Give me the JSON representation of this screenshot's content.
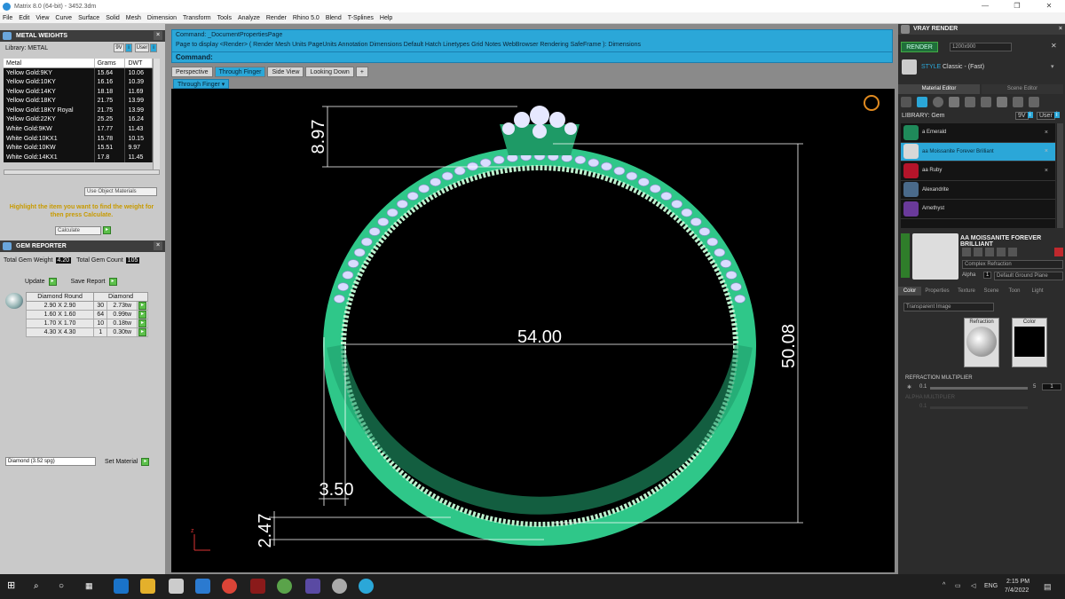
{
  "window": {
    "title": "Matrix 8.0 (64-bit) - 3452.3dm",
    "controls": [
      "—",
      "❐",
      "✕"
    ]
  },
  "menu": [
    "File",
    "Edit",
    "View",
    "Curve",
    "Surface",
    "Solid",
    "Mesh",
    "Dimension",
    "Transform",
    "Tools",
    "Analyze",
    "Render",
    "Rhino 5.0",
    "Blend",
    "T-Splines",
    "Help"
  ],
  "metal_weights": {
    "header": "METAL WEIGHTS",
    "library_label": "Library: METAL",
    "toggles": [
      "9V",
      "i",
      "User",
      "i"
    ],
    "columns": [
      "Metal",
      "Grams",
      "DWT"
    ],
    "rows": [
      [
        "Yellow Gold:9KY",
        "15.64",
        "10.06"
      ],
      [
        "Yellow Gold:10KY",
        "16.16",
        "10.39"
      ],
      [
        "Yellow Gold:14KY",
        "18.18",
        "11.69"
      ],
      [
        "Yellow Gold:18KY",
        "21.75",
        "13.99"
      ],
      [
        "Yellow Gold:18KY Royal",
        "21.75",
        "13.99"
      ],
      [
        "Yellow Gold:22KY",
        "25.25",
        "16.24"
      ],
      [
        "White Gold:9KW",
        "17.77",
        "11.43"
      ],
      [
        "White Gold:10KX1",
        "15.78",
        "10.15"
      ],
      [
        "White Gold:10KW",
        "15.51",
        "9.97"
      ],
      [
        "White Gold:14KX1",
        "17.8",
        "11.45"
      ]
    ],
    "use_object_materials": "Use Object Materials",
    "hint": "Highlight the item you want to find the weight for then press Calculate.",
    "calculate": "Calculate"
  },
  "gem_reporter": {
    "header": "GEM REPORTER",
    "total_weight_label": "Total Gem Weight",
    "total_weight": "4.20",
    "total_count_label": "Total Gem Count",
    "total_count": "105",
    "update": "Update",
    "save_report": "Save Report",
    "columns": [
      "Diamond Round",
      "Diamond"
    ],
    "rows": [
      [
        "2.90 X 2.90",
        "30",
        "2.73tw"
      ],
      [
        "1.60 X 1.60",
        "64",
        "0.99tw"
      ],
      [
        "1.70 X 1.70",
        "10",
        "0.18tw"
      ],
      [
        "4.30 X 4.30",
        "1",
        "0.30tw"
      ]
    ],
    "material_select": "Diamond    (3.52 spg)",
    "set_material": "Set Material"
  },
  "command": {
    "line1": "Command: _DocumentPropertiesPage",
    "line2": "Page to display <Render> ( Render  Mesh  Units  PageUnits  Annotation  Dimensions  Default  Hatch  Linetypes  Grid  Notes  WebBrowser  Rendering  SafeFrame ): Dimensions",
    "prompt": "Command:"
  },
  "viewport_tabs": [
    "Perspective",
    "Through Finger",
    "Side View",
    "Looking Down",
    "+"
  ],
  "active_viewport": "Through Finger",
  "dimensions": {
    "top_height": "8.97",
    "inner_width": "54.00",
    "total_height": "50.08",
    "band_width": "3.50",
    "band_thickness": "2.47"
  },
  "axis": {
    "z": "z"
  },
  "vray": {
    "header": "VRAY RENDER",
    "render": "RENDER",
    "resolution": "1200x900",
    "style_label": "STYLE",
    "style": "Classic - (Fast)",
    "tabs": [
      "Material Editor",
      "Scene Editor"
    ],
    "library_label": "LIBRARY: Gem",
    "toggles": [
      "9V",
      "i",
      "User",
      "i"
    ],
    "materials": [
      {
        "name": "a Emerald",
        "color": "#1f8a5a"
      },
      {
        "name": "aa Moissanite Forever Brilliant",
        "color": "#d8d8d8"
      },
      {
        "name": "aa Ruby",
        "color": "#b5142a"
      },
      {
        "name": "Alexandrite",
        "color": "#4a6a8a"
      },
      {
        "name": "Amethyst",
        "color": "#6a3a9a"
      }
    ],
    "selected_material": "AA MOISSANITE FOREVER BRILLIANT",
    "complex_refraction": "Complex Refraction",
    "alpha_label": "Alpha",
    "alpha_value": "1",
    "ground_plane": "Default Ground Plane",
    "prop_tabs": [
      "Color",
      "Properties",
      "Texture",
      "Scene",
      "Toon",
      "Light"
    ],
    "transparent_image": "Transparent Image",
    "refraction_label": "Refraction",
    "color_label": "Color",
    "refraction_multiplier_label": "REFRACTION MULTIPLIER",
    "rm_min": "0.1",
    "rm_max": "5",
    "rm_value": "1",
    "disabled_label": "ALPHA MULTIPLIER",
    "disabled_min": "0.1"
  },
  "taskbar": {
    "lang": "ENG",
    "time": "2:15 PM",
    "date": "7/4/2022"
  }
}
